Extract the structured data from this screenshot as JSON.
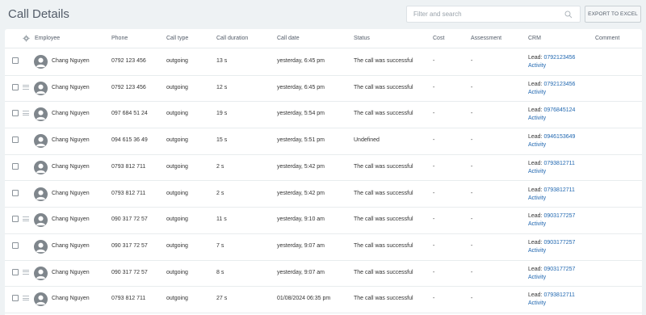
{
  "page": {
    "title": "Call Details"
  },
  "search": {
    "placeholder": "Filter and search"
  },
  "toolbar": {
    "export_label": "EXPORT TO EXCEL"
  },
  "table": {
    "columns": [
      "Employee",
      "Phone",
      "Call type",
      "Call duration",
      "Call date",
      "Status",
      "Cost",
      "Assessment",
      "CRM",
      "Comment"
    ],
    "rows": [
      {
        "has_menu": false,
        "employee": "Chang Nguyen",
        "phone": "0792 123 456",
        "call_type": "outgoing",
        "duration": "13 s",
        "call_date": "yesterday, 6:45 pm",
        "status": "The call was successful",
        "cost": "-",
        "assessment": "-",
        "lead_label": "Lead:",
        "lead_phone": "0792123456",
        "activity": "Activity",
        "comment": ""
      },
      {
        "has_menu": true,
        "employee": "Chang Nguyen",
        "phone": "0792 123 456",
        "call_type": "outgoing",
        "duration": "12 s",
        "call_date": "yesterday, 6:45 pm",
        "status": "The call was successful",
        "cost": "-",
        "assessment": "-",
        "lead_label": "Lead:",
        "lead_phone": "0792123456",
        "activity": "Activity",
        "comment": ""
      },
      {
        "has_menu": true,
        "employee": "Chang Nguyen",
        "phone": "097 684 51 24",
        "call_type": "outgoing",
        "duration": "19 s",
        "call_date": "yesterday, 5:54 pm",
        "status": "The call was successful",
        "cost": "-",
        "assessment": "-",
        "lead_label": "Lead:",
        "lead_phone": "0976845124",
        "activity": "Activity",
        "comment": ""
      },
      {
        "has_menu": false,
        "employee": "Chang Nguyen",
        "phone": "094 615 36 49",
        "call_type": "outgoing",
        "duration": "15 s",
        "call_date": "yesterday, 5:51 pm",
        "status": "Undefined",
        "cost": "-",
        "assessment": "-",
        "lead_label": "Lead:",
        "lead_phone": "0946153649",
        "activity": "Activity",
        "comment": ""
      },
      {
        "has_menu": false,
        "employee": "Chang Nguyen",
        "phone": "0793 812 711",
        "call_type": "outgoing",
        "duration": "2 s",
        "call_date": "yesterday, 5:42 pm",
        "status": "The call was successful",
        "cost": "-",
        "assessment": "-",
        "lead_label": "Lead:",
        "lead_phone": "0793812711",
        "activity": "Activity",
        "comment": ""
      },
      {
        "has_menu": false,
        "employee": "Chang Nguyen",
        "phone": "0793 812 711",
        "call_type": "outgoing",
        "duration": "2 s",
        "call_date": "yesterday, 5:42 pm",
        "status": "The call was successful",
        "cost": "-",
        "assessment": "-",
        "lead_label": "Lead:",
        "lead_phone": "0793812711",
        "activity": "Activity",
        "comment": ""
      },
      {
        "has_menu": true,
        "employee": "Chang Nguyen",
        "phone": "090 317 72 57",
        "call_type": "outgoing",
        "duration": "11 s",
        "call_date": "yesterday, 9:10 am",
        "status": "The call was successful",
        "cost": "-",
        "assessment": "-",
        "lead_label": "Lead:",
        "lead_phone": "0903177257",
        "activity": "Activity",
        "comment": ""
      },
      {
        "has_menu": false,
        "employee": "Chang Nguyen",
        "phone": "090 317 72 57",
        "call_type": "outgoing",
        "duration": "7 s",
        "call_date": "yesterday, 9:07 am",
        "status": "The call was successful",
        "cost": "-",
        "assessment": "-",
        "lead_label": "Lead:",
        "lead_phone": "0903177257",
        "activity": "Activity",
        "comment": ""
      },
      {
        "has_menu": true,
        "employee": "Chang Nguyen",
        "phone": "090 317 72 57",
        "call_type": "outgoing",
        "duration": "8 s",
        "call_date": "yesterday, 9:07 am",
        "status": "The call was successful",
        "cost": "-",
        "assessment": "-",
        "lead_label": "Lead:",
        "lead_phone": "0903177257",
        "activity": "Activity",
        "comment": ""
      },
      {
        "has_menu": true,
        "employee": "Chang Nguyen",
        "phone": "0793 812 711",
        "call_type": "outgoing",
        "duration": "27 s",
        "call_date": "01/08/2024 06:35 pm",
        "status": "The call was successful",
        "cost": "-",
        "assessment": "-",
        "lead_label": "Lead:",
        "lead_phone": "0793812711",
        "activity": "Activity",
        "comment": ""
      }
    ]
  },
  "colors": {
    "link": "#2067b0",
    "avatar": "#7f868c",
    "background": "#eef2f4"
  }
}
